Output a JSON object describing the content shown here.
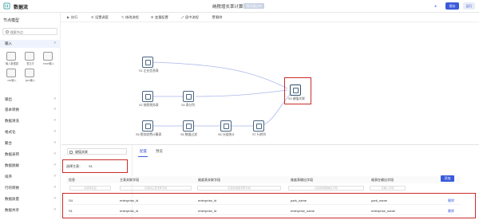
{
  "app": {
    "title": "数据流",
    "task_title": "纳税增长率计算",
    "status_badge": "测试通过中",
    "pin_label": "★",
    "save_label": "保存",
    "run_label": "运行"
  },
  "sidebar": {
    "title": "节点模型",
    "search_placeholder": "搜索节点",
    "sections": [
      {
        "label": "输入"
      },
      {
        "label": "输出"
      },
      {
        "label": "基本转换"
      },
      {
        "label": "数据清洗"
      },
      {
        "label": "格式化"
      },
      {
        "label": "聚合"
      },
      {
        "label": "数据表转"
      },
      {
        "label": "数据脱敏"
      },
      {
        "label": "排序"
      },
      {
        "label": "行的转换"
      },
      {
        "label": "数据质量"
      },
      {
        "label": "数据共享"
      }
    ],
    "input_nodes": [
      {
        "label": "输入数据源"
      },
      {
        "label": "表交叉"
      },
      {
        "label": "excel输入"
      },
      {
        "label": "csv输入"
      },
      {
        "label": "json输入"
      }
    ]
  },
  "toolbar": {
    "items": [
      {
        "icon": "▶",
        "label": "执行"
      },
      {
        "icon": "⚙",
        "label": "设置调度"
      },
      {
        "icon": "✎",
        "label": "修改流程"
      },
      {
        "icon": "⊞",
        "label": "变量配置"
      },
      {
        "icon": "⤢",
        "label": "居中流程"
      },
      {
        "icon": "🗑",
        "label": "删除"
      }
    ]
  },
  "flow": {
    "nodes": [
      {
        "label": "S1 企业信息表"
      },
      {
        "label": "S2 按照税务表"
      },
      {
        "label": "S4 表分列"
      },
      {
        "label": "S5 税务收费计算表"
      },
      {
        "label": "S6 数据过滤"
      },
      {
        "label": "S6 分组统计"
      },
      {
        "label": "S7 行转列"
      },
      {
        "label": "S3 键值关联"
      }
    ]
  },
  "panel": {
    "node_name": "键值关联",
    "tabs": [
      {
        "label": "配置"
      },
      {
        "label": "预览"
      }
    ],
    "selected_key": "选择主表：",
    "selected_value": "S1",
    "columns": [
      "信息",
      "主表关联字段",
      "维度表关联字段",
      "维度表输出字段",
      "维表在输出字段"
    ],
    "add_label": "添加",
    "filter_placeholders": [
      "请选择信息",
      "请选择主表关联字段",
      "请选择维度关联字段",
      "请选择维度输出字段",
      "请输入字段"
    ],
    "rows": [
      {
        "info": "S4",
        "main_field": "enterprise_id",
        "dim_field": "enterprise_id",
        "dim_out": "park_name",
        "out_name": "park_name",
        "action": "删除"
      },
      {
        "info": "S1",
        "main_field": "enterprise_id",
        "dim_field": "enterprise_id",
        "dim_out": "enterprise_name",
        "out_name": "enterprise_name",
        "action": "删除"
      }
    ]
  }
}
